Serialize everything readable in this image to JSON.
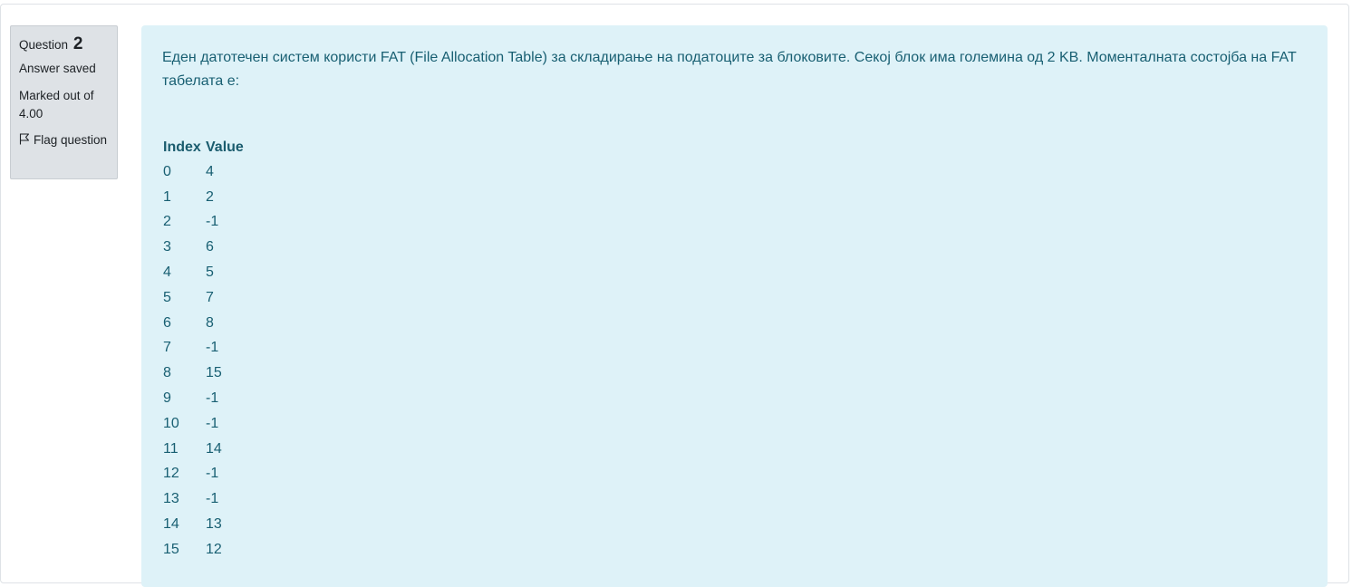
{
  "info": {
    "question_label": "Question",
    "question_number": "2",
    "state": "Answer saved",
    "grade": "Marked out of 4.00",
    "flag_label": "Flag question"
  },
  "question": {
    "text": "Еден датотечен систем користи FAT (File Allocation Table) за складирање на податоците за блоковите. Секој блок има големина од 2 KB.  Моменталната состојба на FAT табелата е:",
    "table": {
      "headers": [
        "Index",
        "Value"
      ],
      "rows": [
        [
          "0",
          "4"
        ],
        [
          "1",
          "2"
        ],
        [
          "2",
          "-1"
        ],
        [
          "3",
          "6"
        ],
        [
          "4",
          "5"
        ],
        [
          "5",
          "7"
        ],
        [
          "6",
          "8"
        ],
        [
          "7",
          "-1"
        ],
        [
          "8",
          "15"
        ],
        [
          "9",
          "-1"
        ],
        [
          "10",
          "-1"
        ],
        [
          "11",
          "14"
        ],
        [
          "12",
          "-1"
        ],
        [
          "13",
          "-1"
        ],
        [
          "14",
          "13"
        ],
        [
          "15",
          "12"
        ]
      ]
    }
  },
  "colors": {
    "info_bg": "#dee2e6",
    "content_bg": "#def2f8",
    "content_text": "#185f72"
  },
  "icons": {
    "flag": "flag-icon"
  }
}
